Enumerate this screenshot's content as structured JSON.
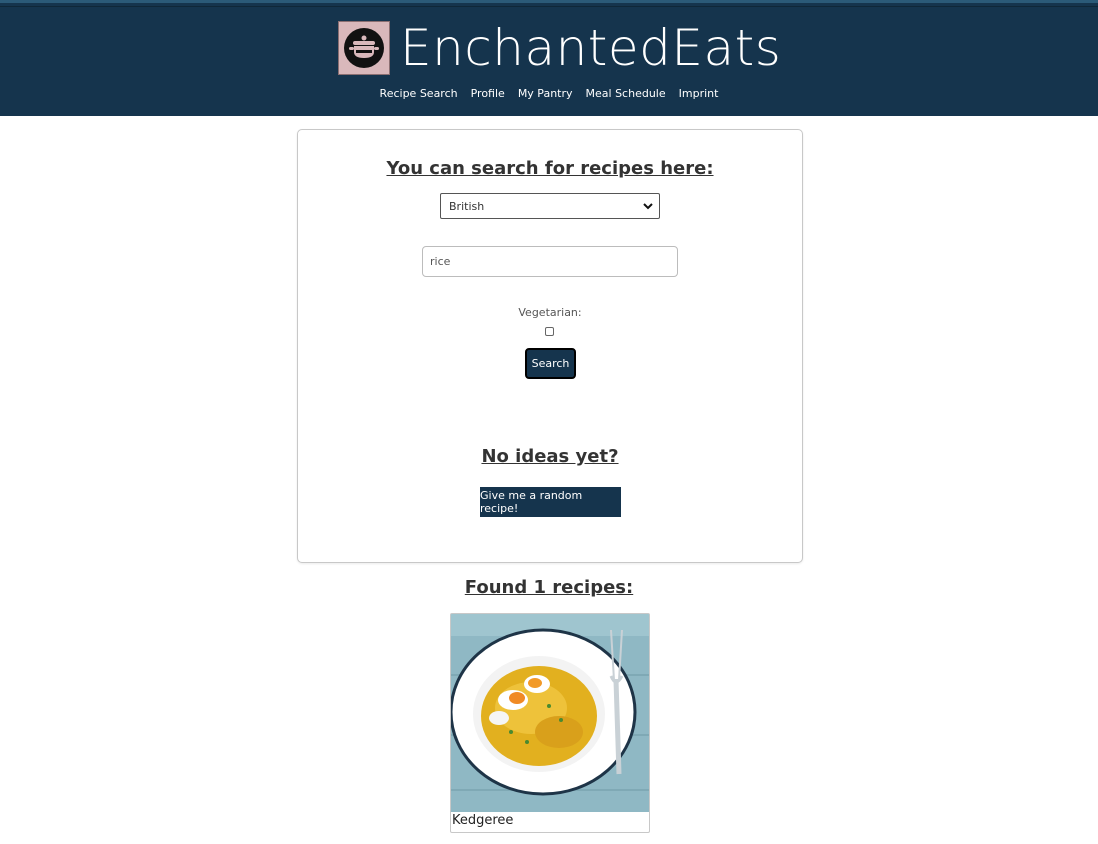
{
  "app": {
    "title": "EnchantedEats",
    "logo_icon": "cooking-pot-icon",
    "brand_color": "#15344d"
  },
  "nav": {
    "items": [
      {
        "label": "Recipe Search"
      },
      {
        "label": "Profile"
      },
      {
        "label": "My Pantry"
      },
      {
        "label": "Meal Schedule"
      },
      {
        "label": "Imprint"
      }
    ]
  },
  "search": {
    "heading": "You can search for recipes here:",
    "cuisine_selected": "British",
    "query_value": "rice",
    "vegetarian_label": "Vegetarian:",
    "vegetarian_checked": false,
    "button_label": "Search"
  },
  "random": {
    "heading": "No ideas yet?",
    "button_label": "Give me a random recipe!"
  },
  "results": {
    "heading": "Found 1 recipes:",
    "items": [
      {
        "name": "Kedgeree",
        "image": "kedgeree-dish-photo"
      }
    ]
  }
}
